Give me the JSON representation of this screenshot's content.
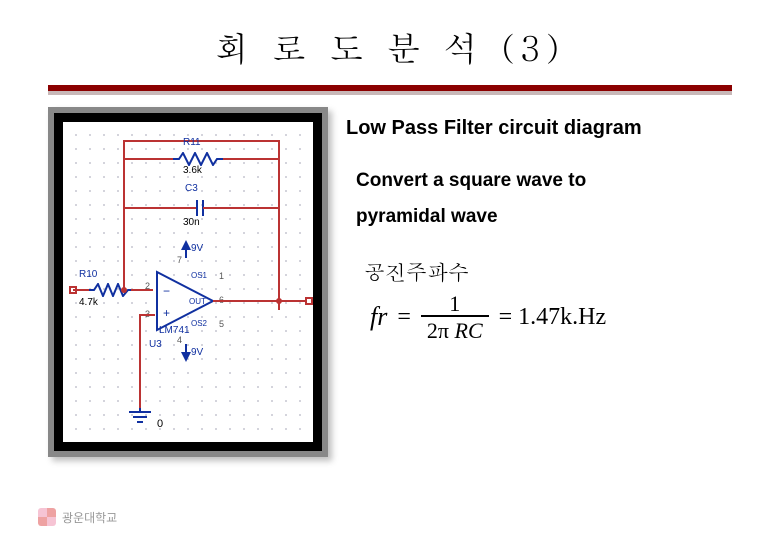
{
  "title": "회 로 도 분 석 (3)",
  "heading": "Low Pass Filter circuit diagram",
  "description_line1": "Convert a square wave to",
  "description_line2": "pyramidal wave",
  "sublabel": "공진주파수",
  "formula": {
    "lhs": "fr",
    "numerator": "1",
    "denom_prefix": "2",
    "denom_pi": "π",
    "denom_rc": "RC",
    "result": "= 1.47k.Hz"
  },
  "schematic": {
    "components": {
      "R11": {
        "ref": "R11",
        "value": "3.6k"
      },
      "C3": {
        "ref": "C3",
        "value": "30n"
      },
      "R10": {
        "ref": "R10",
        "value": "4.7k"
      },
      "U3": {
        "ref": "LM741",
        "designator": "U3"
      }
    },
    "supplies": {
      "vpos": "9V",
      "vneg": "9V"
    },
    "opamp_pins": {
      "in_minus": "2",
      "in_plus": "3",
      "vpos": "7",
      "vneg": "4",
      "out": "6",
      "os1": "OS1",
      "os2": "OS2",
      "os1_pin": "1",
      "os2_pin": "5",
      "out_label": "OUT"
    },
    "ground_label": "0"
  },
  "footer": {
    "text": "광운대학교"
  }
}
